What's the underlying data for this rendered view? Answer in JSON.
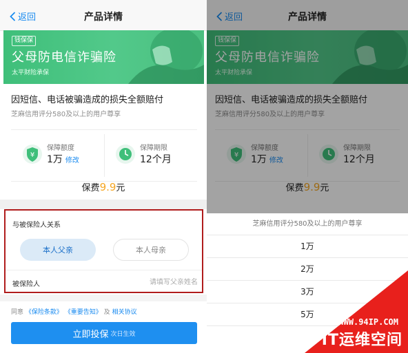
{
  "colors": {
    "accent": "#1a8bf0",
    "banner_green": "#45c27f",
    "price_orange": "#f5a623",
    "highlight_red": "#b01c1c",
    "cta_blue": "#1e8ff0"
  },
  "nav": {
    "back_label": "返回",
    "title": "产品详情"
  },
  "banner": {
    "tag": "钱保保",
    "title": "父母防电信诈骗险",
    "underwriter": "太平财险承保"
  },
  "product": {
    "headline": "因短信、电话被骗造成的损失全额赔付",
    "subline": "芝麻信用评分580及以上的用户尊享",
    "coverage_amount": {
      "label": "保障额度",
      "value": "1万",
      "edit_label": "修改",
      "icon": "shield-yen-icon"
    },
    "coverage_period": {
      "label": "保障期限",
      "value": "12个月",
      "icon": "clock-icon"
    },
    "fee_label": "保费",
    "fee_amount": "9.9",
    "fee_unit": "元"
  },
  "relation": {
    "label": "与被保险人关系",
    "options": [
      "本人父亲",
      "本人母亲"
    ],
    "selected": "本人父亲",
    "insured_label": "被保险人",
    "insured_placeholder": "请填写父亲姓名",
    "insured_value": ""
  },
  "agreement": {
    "prefix": "同意",
    "terms": "《保险条款》",
    "notice": "《重要告知》",
    "and": "及",
    "related": "相关协议"
  },
  "cta": {
    "label": "立即投保",
    "hint": "次日生效"
  },
  "picker": {
    "header": "芝麻信用评分580及以上的用户尊享",
    "options": [
      "1万",
      "2万",
      "3万",
      "5万"
    ]
  },
  "watermark": {
    "url": "WWW.94IP.COM",
    "name": "IT运维空间"
  }
}
